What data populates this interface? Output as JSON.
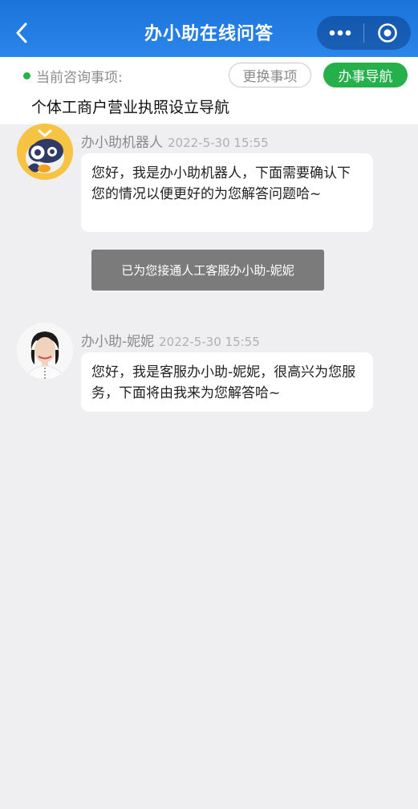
{
  "header": {
    "title": "办小助在线问答",
    "back_icon": "chevron-left-icon",
    "more_icon": "more-dots-icon",
    "close_icon": "target-circle-icon"
  },
  "topic": {
    "label": "当前咨询事项:",
    "value": "个体工商户营业执照设立导航",
    "change_button": "更换事项",
    "nav_button": "办事导航",
    "status_color": "#24b24b",
    "nav_button_color": "#26b04c"
  },
  "messages": [
    {
      "sender": "办小助机器人",
      "time": "2022-5-30 15:55",
      "text": "您好，我是办小助机器人，下面需要确认下您的情况以便更好的为您解答问题哈~",
      "avatar": "robot-mascot-avatar"
    },
    {
      "system": "已为您接通人工客服办小助-妮妮"
    },
    {
      "sender": "办小助-妮妮",
      "time": "2022-5-30 15:55",
      "text": "您好，我是客服办小助-妮妮，很高兴为您服务，下面将由我来为您解答哈~",
      "avatar": "agent-photo-avatar"
    }
  ],
  "colors": {
    "header_blue": "#2b86ea",
    "background": "#efeff1"
  }
}
